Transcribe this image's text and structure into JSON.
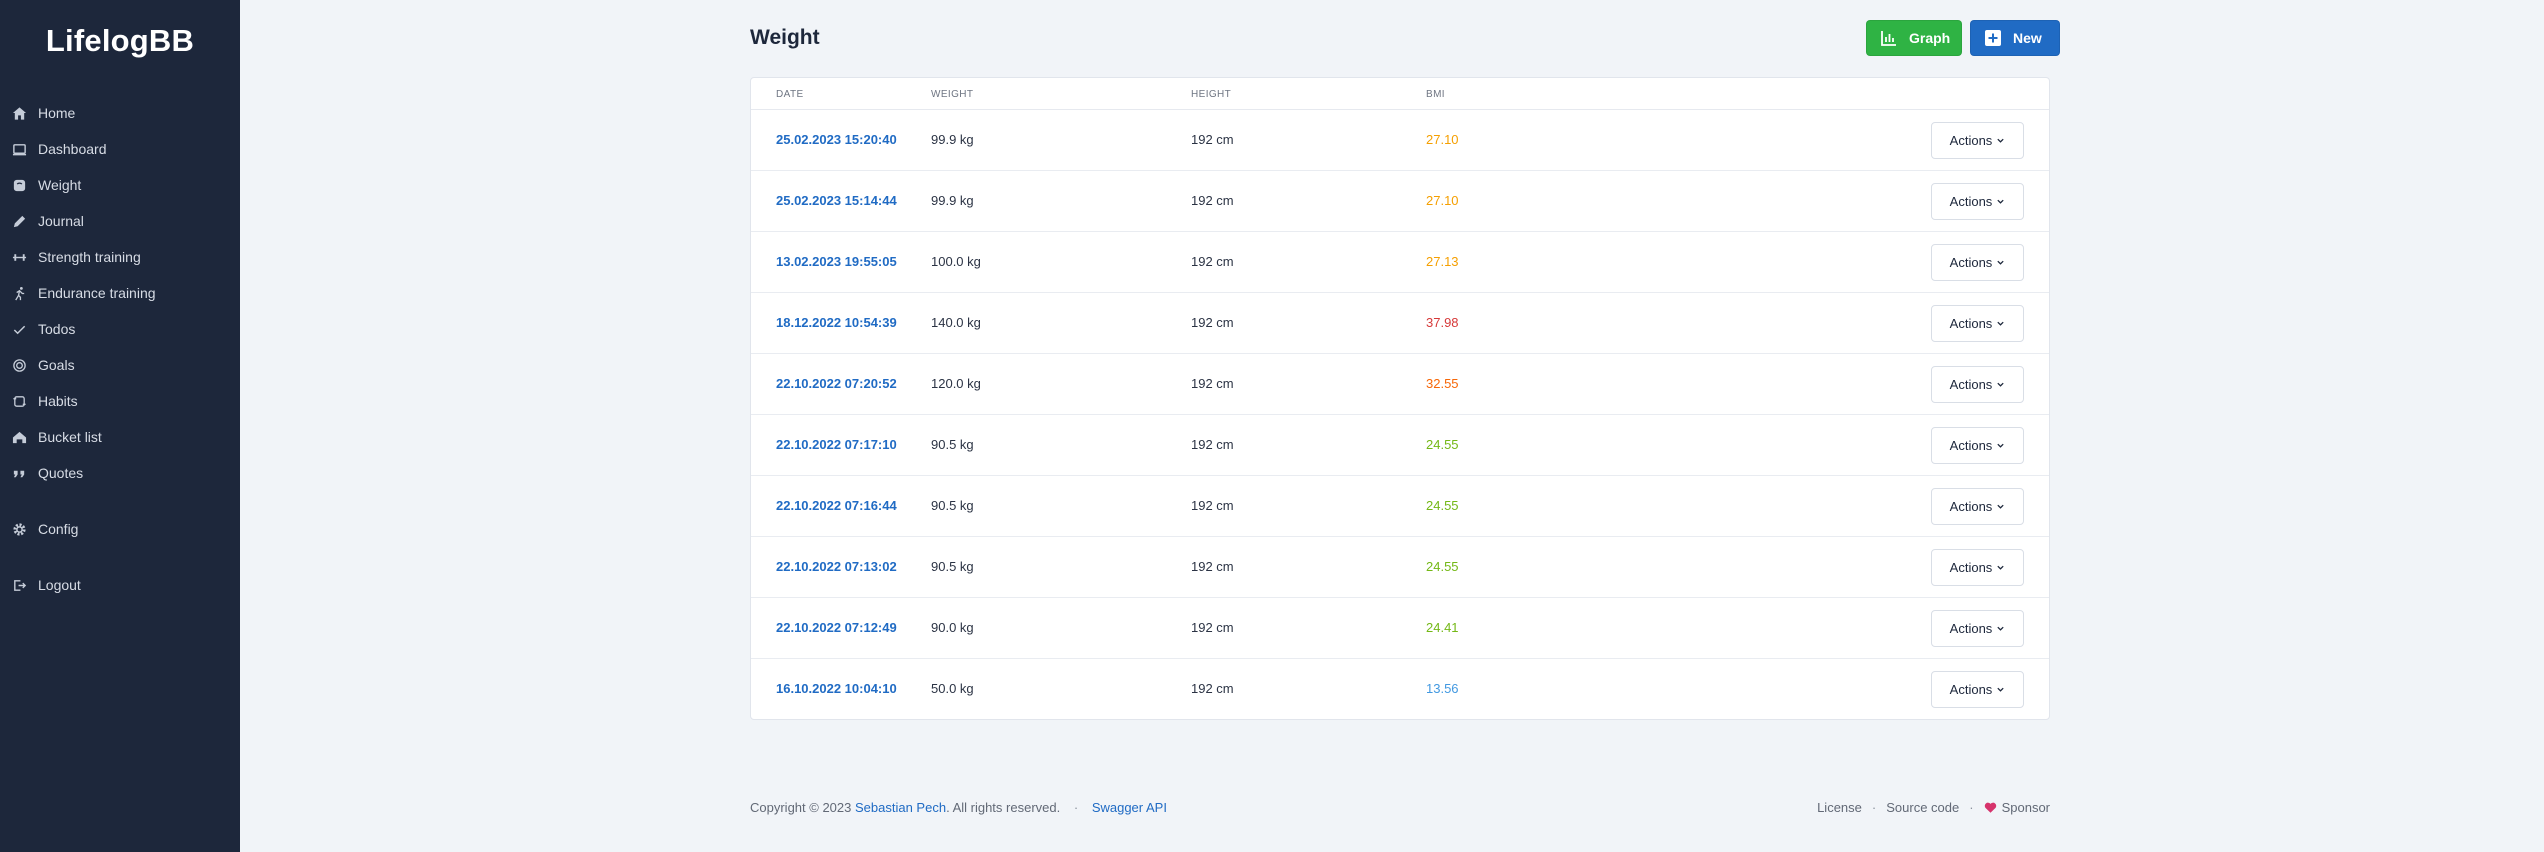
{
  "brand": "LifelogBB",
  "sidebar": {
    "items": [
      {
        "label": "Home",
        "icon": "home-icon"
      },
      {
        "label": "Dashboard",
        "icon": "dashboard-icon"
      },
      {
        "label": "Weight",
        "icon": "scale-icon"
      },
      {
        "label": "Journal",
        "icon": "pencil-icon"
      },
      {
        "label": "Strength training",
        "icon": "barbell-icon"
      },
      {
        "label": "Endurance training",
        "icon": "run-icon"
      },
      {
        "label": "Todos",
        "icon": "check-icon"
      },
      {
        "label": "Goals",
        "icon": "target-icon"
      },
      {
        "label": "Habits",
        "icon": "repeat-icon"
      },
      {
        "label": "Bucket list",
        "icon": "bucket-icon"
      },
      {
        "label": "Quotes",
        "icon": "quote-icon"
      }
    ],
    "config": {
      "label": "Config",
      "icon": "gear-icon"
    },
    "logout": {
      "label": "Logout",
      "icon": "logout-icon"
    }
  },
  "header": {
    "title": "Weight",
    "graph_label": "Graph",
    "new_label": "New"
  },
  "table": {
    "columns": [
      "Date",
      "Weight",
      "Height",
      "BMI"
    ],
    "action_label": "Actions",
    "rows": [
      {
        "date": "25.02.2023 15:20:40",
        "weight": "99.9 kg",
        "height": "192 cm",
        "bmi": "27.10",
        "bmi_color": "#f59f00"
      },
      {
        "date": "25.02.2023 15:14:44",
        "weight": "99.9 kg",
        "height": "192 cm",
        "bmi": "27.10",
        "bmi_color": "#f59f00"
      },
      {
        "date": "13.02.2023 19:55:05",
        "weight": "100.0 kg",
        "height": "192 cm",
        "bmi": "27.13",
        "bmi_color": "#f59f00"
      },
      {
        "date": "18.12.2022 10:54:39",
        "weight": "140.0 kg",
        "height": "192 cm",
        "bmi": "37.98",
        "bmi_color": "#d63939"
      },
      {
        "date": "22.10.2022 07:20:52",
        "weight": "120.0 kg",
        "height": "192 cm",
        "bmi": "32.55",
        "bmi_color": "#f76707"
      },
      {
        "date": "22.10.2022 07:17:10",
        "weight": "90.5 kg",
        "height": "192 cm",
        "bmi": "24.55",
        "bmi_color": "#74b816"
      },
      {
        "date": "22.10.2022 07:16:44",
        "weight": "90.5 kg",
        "height": "192 cm",
        "bmi": "24.55",
        "bmi_color": "#74b816"
      },
      {
        "date": "22.10.2022 07:13:02",
        "weight": "90.5 kg",
        "height": "192 cm",
        "bmi": "24.55",
        "bmi_color": "#74b816"
      },
      {
        "date": "22.10.2022 07:12:49",
        "weight": "90.0 kg",
        "height": "192 cm",
        "bmi": "24.41",
        "bmi_color": "#74b816"
      },
      {
        "date": "16.10.2022 10:04:10",
        "weight": "50.0 kg",
        "height": "192 cm",
        "bmi": "13.56",
        "bmi_color": "#4299e1"
      }
    ]
  },
  "footer": {
    "copyright_prefix": "Copyright © 2023",
    "author": "Sebastian Pech",
    "copyright_suffix": ". All rights reserved.",
    "swagger": "Swagger API",
    "license": "License",
    "source": "Source code",
    "sponsor": "Sponsor"
  }
}
